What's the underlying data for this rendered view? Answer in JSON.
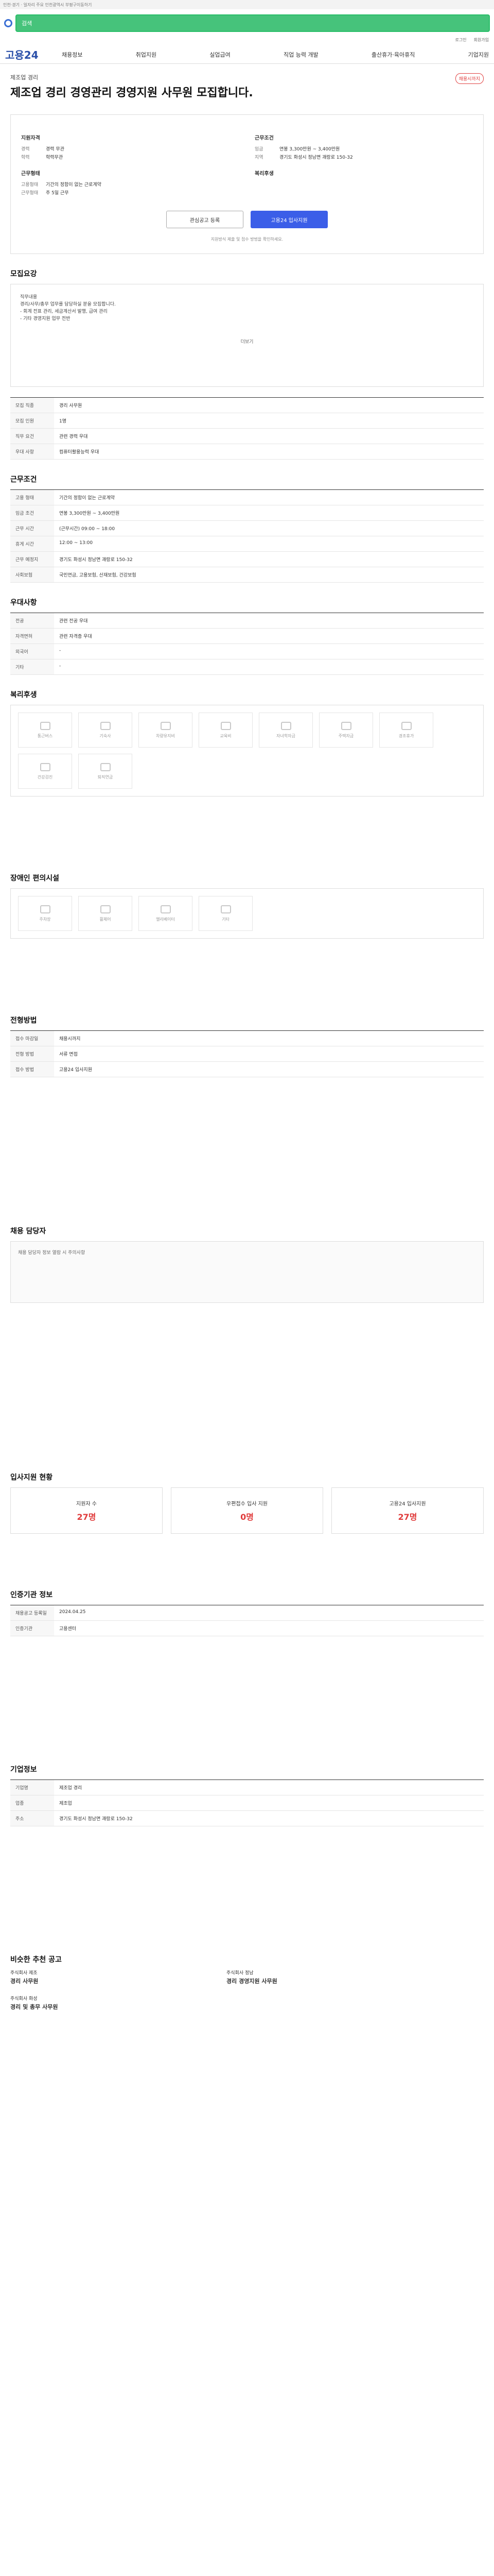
{
  "topbar": "인천·경기 · 일자리 주요 인천광역시 부평구이동하기",
  "search": {
    "placeholder": "검색"
  },
  "util": [
    "로그인",
    "회원가입"
  ],
  "brand": "고용24",
  "nav": [
    "채용정보",
    "취업지원",
    "실업급여",
    "직업 능력 개발",
    "출산휴가·육아휴직",
    "기업지원"
  ],
  "job": {
    "company": "제조업 경리",
    "title": "제조업 경리 경영관리 경영지원 사무원 모집합니다.",
    "badge": "채용시까지"
  },
  "summary": {
    "left_h": "지원자격",
    "left": [
      [
        "경력",
        "경력 무관"
      ],
      [
        "학력",
        "학력무관"
      ]
    ],
    "left_h2": "근무형태",
    "left2": [
      [
        "고용형태",
        "기간의 정함이 없는 근로계약"
      ],
      [
        "근무형태",
        "주 5일 근무"
      ]
    ],
    "right_h": "근무조건",
    "right": [
      [
        "임금",
        "연봉 3,300만원 ~ 3,400만원"
      ],
      [
        "지역",
        "경기도 화성시 정남면 괘랑로 150-32"
      ]
    ],
    "right_h2": "복리후생",
    "save": "관심공고 등록",
    "apply": "고용24 입사지원",
    "notice": "지원방식 제출 및 접수 방법을 확인하세요."
  },
  "detail": {
    "h": "모집요강",
    "text": [
      "직무내용",
      "경리/사무/총무 업무를 담당하실 분을 모집합니다.",
      "- 회계 전표 관리, 세금계산서 발행, 급여 관리",
      "- 기타 경영지원 업무 전반"
    ],
    "more": "더보기"
  },
  "rows1": [
    [
      "모집 직종",
      "경리 사무원"
    ],
    [
      "모집 인원",
      "1명"
    ],
    [
      "직무 요건",
      "관련 경력 우대"
    ],
    [
      "우대 사항",
      "컴퓨터활용능력 우대"
    ]
  ],
  "cond": {
    "h": "근무조건",
    "rows": [
      [
        "고용 형태",
        "기간의 정함이 없는 근로계약"
      ],
      [
        "임금 조건",
        "연봉 3,300만원 ~ 3,400만원"
      ],
      [
        "근무 시간",
        "(근무시간) 09:00 ~ 18:00"
      ],
      [
        "휴게 시간",
        "12:00 ~ 13:00"
      ],
      [
        "근무 예정지",
        "경기도 화성시 정남면 괘랑로 150-32"
      ],
      [
        "사회보험",
        "국민연금, 고용보험, 산재보험, 건강보험"
      ]
    ]
  },
  "prep": {
    "h": "우대사항",
    "rows": [
      [
        "전공",
        "관련 전공 우대"
      ],
      [
        "자격면허",
        "관련 자격증 우대"
      ],
      [
        "외국어",
        "-"
      ],
      [
        "기타",
        "-"
      ]
    ]
  },
  "welfare": {
    "h": "복리후생",
    "tiles": [
      "통근버스",
      "기숙사",
      "차량유지비",
      "교육비",
      "자녀학자금",
      "주택자금",
      "경조휴가",
      "건강검진",
      "퇴직연금"
    ]
  },
  "disabled": {
    "h": "장애인 편의시설",
    "tiles": [
      "주차장",
      "휠체어",
      "엘리베이터",
      "기타"
    ]
  },
  "apply": {
    "h": "전형방법",
    "rows": [
      [
        "접수 마감일",
        "채용시까지"
      ],
      [
        "전형 방법",
        "서류 면접"
      ],
      [
        "접수 방법",
        "고용24 입사지원"
      ]
    ]
  },
  "contact": {
    "h": "채용 담당자",
    "msg": "채용 담당자 정보 열람 시 주의사항"
  },
  "stats": {
    "h": "입사지원 현황",
    "items": [
      [
        "지원자 수",
        "27명"
      ],
      [
        "우편접수 입사 지원",
        "0명"
      ],
      [
        "고용24 입사지원",
        "27명"
      ]
    ]
  },
  "org": {
    "h": "인증기관 정보",
    "rows": [
      [
        "채용공고 등록일",
        "2024.04.25"
      ],
      [
        "인증기관",
        "고용센터"
      ]
    ]
  },
  "company": {
    "h": "기업정보",
    "rows": [
      [
        "기업명",
        "제조업 경리"
      ],
      [
        "업종",
        "제조업"
      ],
      [
        "주소",
        "경기도 화성시 정남면 괘랑로 150-32"
      ]
    ]
  },
  "similar": {
    "h": "비슷한 추천 공고",
    "items": [
      [
        "경리 사무원",
        "주식회사 제조"
      ],
      [
        "경리 경영지원 사무원",
        "주식회사 정남"
      ],
      [
        "경리 및 총무 사무원",
        "주식회사 화성"
      ]
    ]
  }
}
